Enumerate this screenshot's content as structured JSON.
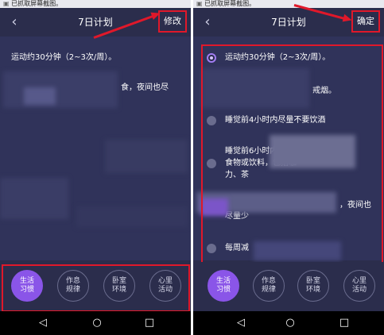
{
  "colors": {
    "accent": "#8a55e8",
    "annotation_red": "#e0182a",
    "background": "#2b2d4c"
  },
  "left_screen": {
    "status_text": "已抓取屏幕截图。",
    "title": "7日计划",
    "back_icon": "‹",
    "action_label": "修改",
    "rows": [
      "运动约30分钟（2~3次/周）。",
      "食，夜间也尽"
    ],
    "tabs": [
      {
        "line1": "生活",
        "line2": "习惯",
        "active": true
      },
      {
        "line1": "作息",
        "line2": "规律",
        "active": false
      },
      {
        "line1": "卧室",
        "line2": "环境",
        "active": false
      },
      {
        "line1": "心里",
        "line2": "活动",
        "active": false
      }
    ]
  },
  "right_screen": {
    "status_text": "已抓取屏幕截图。",
    "title": "7日计划",
    "back_icon": "‹",
    "action_label": "确定",
    "options": [
      {
        "text": "运动约30分钟（2~3次/周）。",
        "selected": true
      },
      {
        "text": "戒烟。",
        "selected": false
      },
      {
        "text": "睡觉前4小时内尽量不要饮酒",
        "selected": false
      },
      {
        "text": "睡觉前6小时内",
        "line2": "食物或饮料，包括咖",
        "line3": "力、茶",
        "selected": false
      },
      {
        "text": "，夜间也",
        "line2": "尽量少",
        "selected": false
      },
      {
        "text": "每周减",
        "selected": false
      }
    ],
    "tabs": [
      {
        "line1": "生活",
        "line2": "习惯",
        "active": true
      },
      {
        "line1": "作息",
        "line2": "规律",
        "active": false
      },
      {
        "line1": "卧室",
        "line2": "环境",
        "active": false
      },
      {
        "line1": "心里",
        "line2": "活动",
        "active": false
      }
    ]
  },
  "navbar": {
    "back": "◁",
    "home": "○",
    "recent": "□"
  }
}
